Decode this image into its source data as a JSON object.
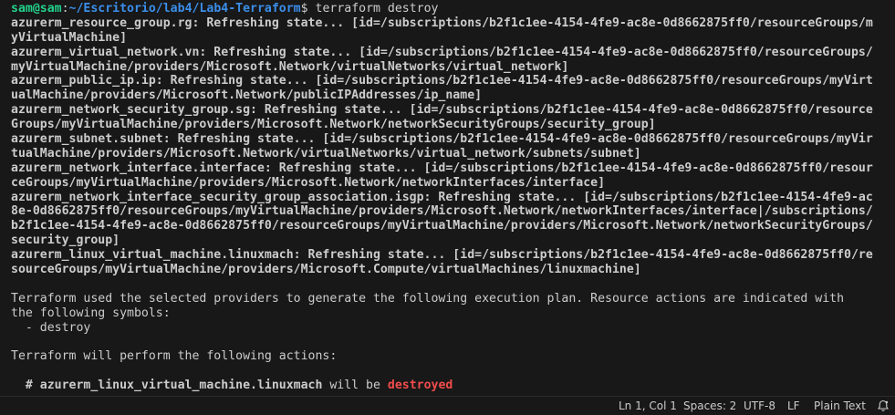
{
  "prompt": {
    "user": "sam@sam",
    "path": "~/Escritorio/lab4/Lab4-Terraform",
    "symbol": "$",
    "command": "terraform destroy"
  },
  "output_lines": [
    {
      "text": "azurerm_resource_group.rg: Refreshing state... [id=/subscriptions/b2f1c1ee-4154-4fe9-ac8e-0d8662875ff0/resourceGroups/m"
    },
    {
      "text": "yVirtualMachine]"
    },
    {
      "text": "azurerm_virtual_network.vn: Refreshing state... [id=/subscriptions/b2f1c1ee-4154-4fe9-ac8e-0d8662875ff0/resourceGroups/"
    },
    {
      "text": "myVirtualMachine/providers/Microsoft.Network/virtualNetworks/virtual_network]"
    },
    {
      "text": "azurerm_public_ip.ip: Refreshing state... [id=/subscriptions/b2f1c1ee-4154-4fe9-ac8e-0d8662875ff0/resourceGroups/myVirt"
    },
    {
      "text": "ualMachine/providers/Microsoft.Network/publicIPAddresses/ip_name]"
    },
    {
      "text": "azurerm_network_security_group.sg: Refreshing state... [id=/subscriptions/b2f1c1ee-4154-4fe9-ac8e-0d8662875ff0/resource"
    },
    {
      "text": "Groups/myVirtualMachine/providers/Microsoft.Network/networkSecurityGroups/security_group]"
    },
    {
      "text": "azurerm_subnet.subnet: Refreshing state... [id=/subscriptions/b2f1c1ee-4154-4fe9-ac8e-0d8662875ff0/resourceGroups/myVir"
    },
    {
      "text": "tualMachine/providers/Microsoft.Network/virtualNetworks/virtual_network/subnets/subnet]"
    },
    {
      "text": "azurerm_network_interface.interface: Refreshing state... [id=/subscriptions/b2f1c1ee-4154-4fe9-ac8e-0d8662875ff0/resour"
    },
    {
      "text": "ceGroups/myVirtualMachine/providers/Microsoft.Network/networkInterfaces/interface]"
    },
    {
      "text": "azurerm_network_interface_security_group_association.isgp: Refreshing state... [id=/subscriptions/b2f1c1ee-4154-4fe9-ac"
    },
    {
      "text": "8e-0d8662875ff0/resourceGroups/myVirtualMachine/providers/Microsoft.Network/networkInterfaces/interface|/subscriptions/"
    },
    {
      "text": "b2f1c1ee-4154-4fe9-ac8e-0d8662875ff0/resourceGroups/myVirtualMachine/providers/Microsoft.Network/networkSecurityGroups/"
    },
    {
      "text": "security_group]"
    },
    {
      "text": "azurerm_linux_virtual_machine.linuxmach: Refreshing state... [id=/subscriptions/b2f1c1ee-4154-4fe9-ac8e-0d8662875ff0/re"
    },
    {
      "text": "sourceGroups/myVirtualMachine/providers/Microsoft.Compute/virtualMachines/linuxmachine]"
    },
    {
      "text": ""
    },
    {
      "text": "Terraform used the selected providers to generate the following execution plan. Resource actions are indicated with"
    },
    {
      "text": "the following symbols:"
    },
    {
      "text": "  - destroy"
    },
    {
      "text": ""
    },
    {
      "text": "Terraform will perform the following actions:"
    },
    {
      "text": ""
    }
  ],
  "action_line": {
    "prefix": "  # ",
    "resource": "azurerm_linux_virtual_machine.linuxmach",
    "middle": " will be ",
    "status": "destroyed"
  },
  "statusbar": {
    "cursor": "Ln 1, Col 1",
    "spaces": "Spaces: 2",
    "encoding": "UTF-8",
    "eol": "LF",
    "language": "Plain Text"
  },
  "colors": {
    "background": "#181818",
    "text": "#cccccc",
    "prompt_user": "#23d18b",
    "prompt_path": "#3b8eea",
    "destroy": "#f14c4c"
  },
  "icons": {
    "notifications": "bell-icon"
  }
}
